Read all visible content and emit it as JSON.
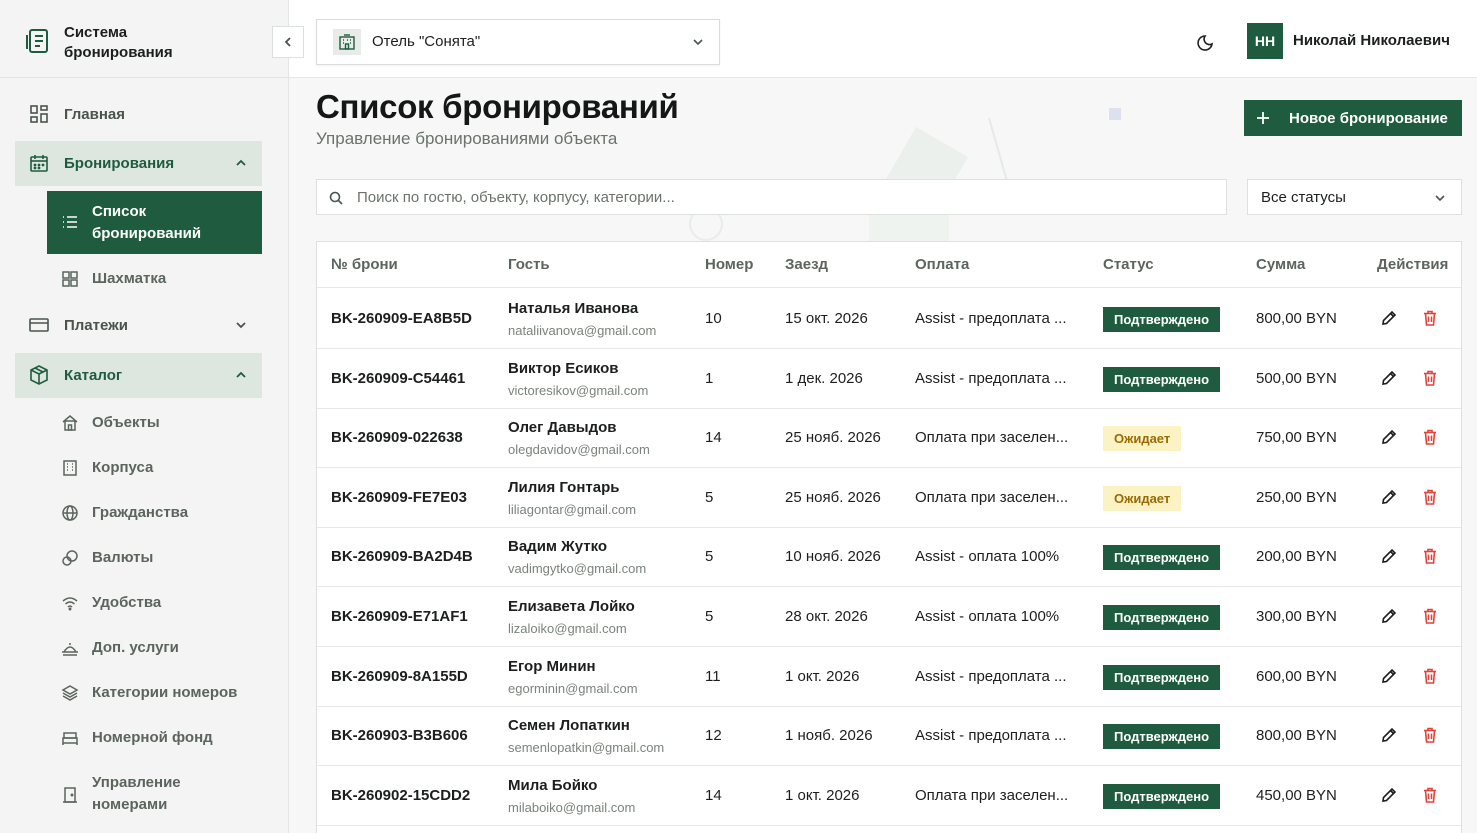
{
  "app": {
    "brand": "Система бронирования",
    "hotel": "Отель \"Сонята\"",
    "user_initials": "НН",
    "user_name": "Николай Николаевич"
  },
  "sidebar": {
    "items": [
      {
        "label": "Главная",
        "icon": "dashboard-icon"
      },
      {
        "label": "Бронирования",
        "icon": "calendar-icon",
        "open": true
      },
      {
        "label": "Платежи",
        "icon": "card-icon"
      },
      {
        "label": "Каталог",
        "icon": "box-icon",
        "open": true
      }
    ],
    "bookings_sub": [
      {
        "label": "Список бронирований",
        "icon": "list-icon",
        "active": true
      },
      {
        "label": "Шахматка",
        "icon": "grid-icon"
      }
    ],
    "catalog_sub": [
      {
        "label": "Объекты",
        "icon": "home-icon"
      },
      {
        "label": "Корпуса",
        "icon": "building-icon"
      },
      {
        "label": "Гражданства",
        "icon": "globe-icon"
      },
      {
        "label": "Валюты",
        "icon": "coins-icon"
      },
      {
        "label": "Удобства",
        "icon": "wifi-icon"
      },
      {
        "label": "Доп. услуги",
        "icon": "service-icon"
      },
      {
        "label": "Категории номеров",
        "icon": "layers-icon"
      },
      {
        "label": "Номерной фонд",
        "icon": "bed-icon"
      },
      {
        "label": "Управление номерами",
        "icon": "door-icon"
      }
    ]
  },
  "page": {
    "title": "Список бронирований",
    "subtitle": "Управление бронированиями объекта",
    "new_button": "Новое бронирование",
    "search_placeholder": "Поиск по гостю, объекту, корпусу, категории...",
    "status_filter": "Все статусы"
  },
  "table": {
    "headers": [
      "№ брони",
      "Гость",
      "Номер",
      "Заезд",
      "Оплата",
      "Статус",
      "Сумма",
      "Действия"
    ],
    "rows": [
      {
        "id": "BK-260909-EA8B5D",
        "name": "Наталья Иванова",
        "email": "nataliivanova@gmail.com",
        "room": "10",
        "checkin": "15 окт. 2026",
        "payment": "Assist - предоплата ...",
        "status": "Подтверждено",
        "status_type": "ok",
        "sum": "800,00 BYN"
      },
      {
        "id": "BK-260909-C54461",
        "name": "Виктор Есиков",
        "email": "victoresikov@gmail.com",
        "room": "1",
        "checkin": "1 дек. 2026",
        "payment": "Assist - предоплата ...",
        "status": "Подтверждено",
        "status_type": "ok",
        "sum": "500,00 BYN"
      },
      {
        "id": "BK-260909-022638",
        "name": "Олег Давыдов",
        "email": "olegdavidov@gmail.com",
        "room": "14",
        "checkin": "25 нояб. 2026",
        "payment": "Оплата при заселен...",
        "status": "Ожидает",
        "status_type": "wait",
        "sum": "750,00 BYN"
      },
      {
        "id": "BK-260909-FE7E03",
        "name": "Лилия Гонтарь",
        "email": "liliagontar@gmail.com",
        "room": "5",
        "checkin": "25 нояб. 2026",
        "payment": "Оплата при заселен...",
        "status": "Ожидает",
        "status_type": "wait",
        "sum": "250,00 BYN"
      },
      {
        "id": "BK-260909-BA2D4B",
        "name": "Вадим Жутко",
        "email": "vadimgytko@gmail.com",
        "room": "5",
        "checkin": "10 нояб. 2026",
        "payment": "Assist - оплата 100%",
        "status": "Подтверждено",
        "status_type": "ok",
        "sum": "200,00 BYN"
      },
      {
        "id": "BK-260909-E71AF1",
        "name": "Елизавета Лойко",
        "email": "lizaloiko@gmail.com",
        "room": "5",
        "checkin": "28 окт. 2026",
        "payment": "Assist - оплата 100%",
        "status": "Подтверждено",
        "status_type": "ok",
        "sum": "300,00 BYN"
      },
      {
        "id": "BK-260909-8A155D",
        "name": "Егор Минин",
        "email": "egorminin@gmail.com",
        "room": "11",
        "checkin": "1 окт. 2026",
        "payment": "Assist - предоплата ...",
        "status": "Подтверждено",
        "status_type": "ok",
        "sum": "600,00 BYN"
      },
      {
        "id": "BK-260903-B3B606",
        "name": "Семен Лопаткин",
        "email": "semenlopatkin@gmail.com",
        "room": "12",
        "checkin": "1 нояб. 2026",
        "payment": "Assist - предоплата ...",
        "status": "Подтверждено",
        "status_type": "ok",
        "sum": "800,00 BYN"
      },
      {
        "id": "BK-260902-15CDD2",
        "name": "Мила Бойко",
        "email": "milaboiko@gmail.com",
        "room": "14",
        "checkin": "1 окт. 2026",
        "payment": "Оплата при заселен...",
        "status": "Подтверждено",
        "status_type": "ok",
        "sum": "450,00 BYN"
      }
    ]
  },
  "colors": {
    "accent": "#1f5c3f",
    "danger": "#e0443a",
    "pending_bg": "#fbf3c4"
  }
}
